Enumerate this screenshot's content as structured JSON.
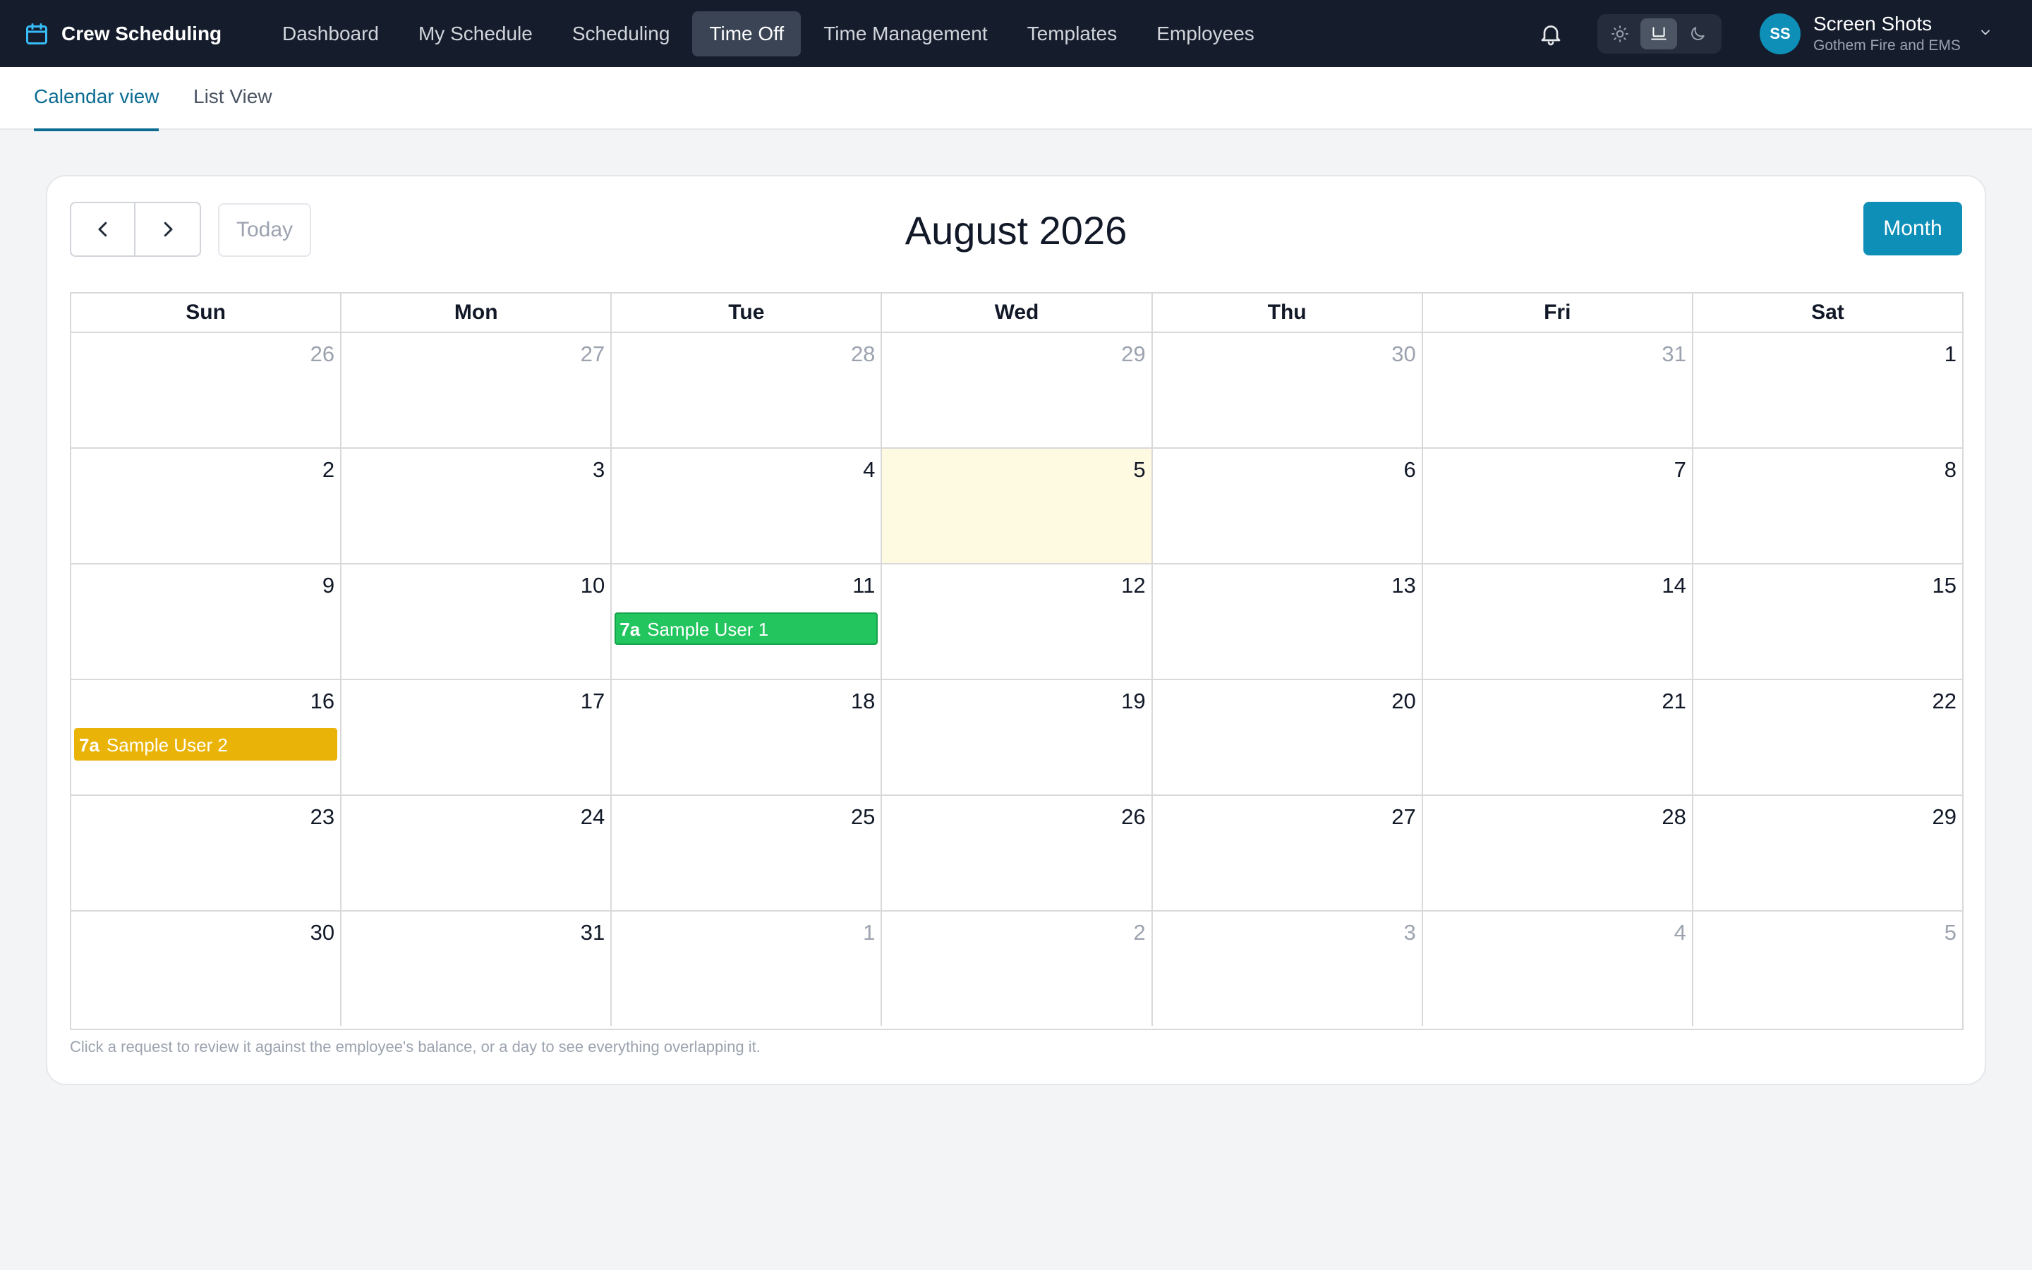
{
  "app": {
    "brand": "Crew Scheduling"
  },
  "nav": {
    "items": [
      {
        "label": "Dashboard"
      },
      {
        "label": "My Schedule"
      },
      {
        "label": "Scheduling"
      },
      {
        "label": "Time Off",
        "active": true
      },
      {
        "label": "Time Management"
      },
      {
        "label": "Templates"
      },
      {
        "label": "Employees"
      }
    ]
  },
  "theme": {
    "options": [
      "sun-icon",
      "monitor-icon",
      "moon-icon"
    ],
    "selected": "monitor-icon"
  },
  "user": {
    "initials": "SS",
    "name": "Screen Shots",
    "org": "Gothem Fire and EMS"
  },
  "subtabs": [
    {
      "label": "Calendar view",
      "active": true
    },
    {
      "label": "List View"
    }
  ],
  "calendar": {
    "today_label": "Today",
    "title": "August 2026",
    "view_label": "Month",
    "weekdays": [
      "Sun",
      "Mon",
      "Tue",
      "Wed",
      "Thu",
      "Fri",
      "Sat"
    ],
    "weeks": [
      [
        {
          "day": "26",
          "muted": true
        },
        {
          "day": "27",
          "muted": true
        },
        {
          "day": "28",
          "muted": true
        },
        {
          "day": "29",
          "muted": true
        },
        {
          "day": "30",
          "muted": true
        },
        {
          "day": "31",
          "muted": true
        },
        {
          "day": "1"
        }
      ],
      [
        {
          "day": "2"
        },
        {
          "day": "3"
        },
        {
          "day": "4"
        },
        {
          "day": "5",
          "today": true
        },
        {
          "day": "6"
        },
        {
          "day": "7"
        },
        {
          "day": "8"
        }
      ],
      [
        {
          "day": "9"
        },
        {
          "day": "10"
        },
        {
          "day": "11",
          "event": {
            "time": "7a",
            "title": "Sample User 1",
            "color": "#22c55e",
            "border": "#16a34a"
          }
        },
        {
          "day": "12"
        },
        {
          "day": "13"
        },
        {
          "day": "14"
        },
        {
          "day": "15"
        }
      ],
      [
        {
          "day": "16",
          "event": {
            "time": "7a",
            "title": "Sample User 2",
            "color": "#eab308",
            "border": "#eab308"
          }
        },
        {
          "day": "17"
        },
        {
          "day": "18"
        },
        {
          "day": "19"
        },
        {
          "day": "20"
        },
        {
          "day": "21"
        },
        {
          "day": "22"
        }
      ],
      [
        {
          "day": "23"
        },
        {
          "day": "24"
        },
        {
          "day": "25"
        },
        {
          "day": "26"
        },
        {
          "day": "27"
        },
        {
          "day": "28"
        },
        {
          "day": "29"
        }
      ],
      [
        {
          "day": "30"
        },
        {
          "day": "31"
        },
        {
          "day": "1",
          "muted": true
        },
        {
          "day": "2",
          "muted": true
        },
        {
          "day": "3",
          "muted": true
        },
        {
          "day": "4",
          "muted": true
        },
        {
          "day": "5",
          "muted": true
        }
      ]
    ],
    "hint": "Click a request to review it against the employee's balance, or a day to see everything overlapping it."
  },
  "colors": {
    "navbar_bg": "#151c2c",
    "accent": "#0e8fb7",
    "tab_active": "#0b6c91",
    "today_bg": "#fef9e1"
  }
}
